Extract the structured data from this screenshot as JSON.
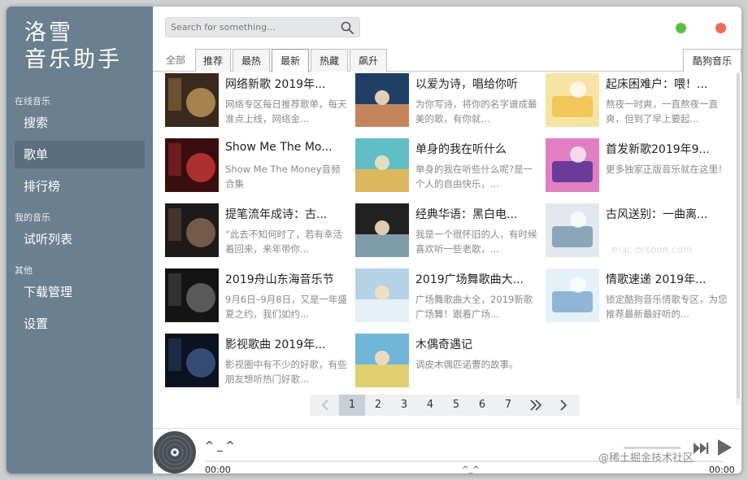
{
  "app": {
    "logo_line1": "洛雪",
    "logo_line2": "音乐助手"
  },
  "sidebar": {
    "sections": [
      {
        "label": "在线音乐"
      },
      {
        "label": "我的音乐"
      },
      {
        "label": "其他"
      }
    ],
    "items": [
      {
        "label": "搜索"
      },
      {
        "label": "歌单"
      },
      {
        "label": "排行榜"
      },
      {
        "label": "试听列表"
      },
      {
        "label": "下载管理"
      },
      {
        "label": "设置"
      }
    ]
  },
  "search": {
    "placeholder": "Search for something..."
  },
  "window": {
    "green_dot_color": "#5cbf4a",
    "red_dot_color": "#ef6b5a"
  },
  "tabs": [
    {
      "label": "全部"
    },
    {
      "label": "推荐"
    },
    {
      "label": "最热"
    },
    {
      "label": "最新"
    },
    {
      "label": "热藏"
    },
    {
      "label": "飙升"
    }
  ],
  "source_tab": {
    "label": "酷狗音乐"
  },
  "playlists": [
    {
      "title": "网络新歌 2019年...",
      "desc": "网络专区每日推荐歌单，每天准点上线，网络金...",
      "color1": "#3a2a1e",
      "color2": "#c29a5a"
    },
    {
      "title": "以爱为诗，唱给你听",
      "desc": "为你写诗，将你的名字谱成最美的歌，有你就...",
      "color1": "#1f3f66",
      "color2": "#e3925a"
    },
    {
      "title": "起床困难户：喂！...",
      "desc": "熬夜一时爽，一直熬夜一直爽，但到了早上要起...",
      "color1": "#f2c65a",
      "color2": "#f7e3a3"
    },
    {
      "title": "Show Me The Mo...",
      "desc": "Show Me The Money音频合集",
      "color1": "#3a0e0e",
      "color2": "#c93a3a"
    },
    {
      "title": "单身的我在听什么",
      "desc": "单身的我在听些什么呢?是一个人的自由快乐，...",
      "color1": "#5fbfc5",
      "color2": "#f3b54a"
    },
    {
      "title": "首发新歌2019年9...",
      "desc": "更多独家正版音乐就在这里！",
      "color1": "#6b3b9a",
      "color2": "#e07fc2"
    },
    {
      "title": "提笔流年成诗：古...",
      "desc": "“此去不知何时了，若有幸活着回来，来年带你...",
      "color1": "#1e1a1a",
      "color2": "#8a6a55"
    },
    {
      "title": "经典华语：黑白电...",
      "desc": "我是一个很怀旧的人，有时候喜欢听一些老歌，...",
      "color1": "#222222",
      "color2": "#8fb3bf"
    },
    {
      "title": "古风送别：一曲离...",
      "desc": "",
      "color1": "#8aa5b8",
      "color2": "#e2e8ee"
    },
    {
      "title": "2019舟山东海音乐节",
      "desc": "9月6日–9月8日，又是一年盛夏之约，我们如约...",
      "color1": "#141414",
      "color2": "#6a6a6a"
    },
    {
      "title": "2019广场舞歌曲大...",
      "desc": "广场舞歌曲大全，2019新歌广场舞！跟着广场...",
      "color1": "#b6d2e6",
      "color2": "#f0f5f9"
    },
    {
      "title": "情歌速递 2019年...",
      "desc": "锁定酷狗音乐情歌专区，为您推荐最新最好听的...",
      "color1": "#8fb5d6",
      "color2": "#e6f0f7"
    },
    {
      "title": "影视歌曲 2019年...",
      "desc": "影视圈中有不少的好歌，有些朋友想听热门好歌...",
      "color1": "#0d1220",
      "color2": "#3e5a8a"
    },
    {
      "title": "木偶奇遇记",
      "desc": "调皮木偶匹诺曹的故事。",
      "color1": "#6fb6d9",
      "color2": "#f5d35a"
    }
  ],
  "pager": {
    "pages": [
      "1",
      "2",
      "3",
      "4",
      "5",
      "6",
      "7"
    ],
    "current": "1",
    "prev_icon": "chevron-left-icon",
    "more_icon": "double-chevron-right-icon",
    "next_icon": "chevron-right-icon"
  },
  "player": {
    "song_name": "^ _ ^",
    "time_current": "00:00",
    "time_mid": "^_^",
    "time_total": "00:00"
  },
  "watermarks": {
    "site1": "mac.orsoon.com",
    "site2": "@稀土掘金技术社区"
  }
}
